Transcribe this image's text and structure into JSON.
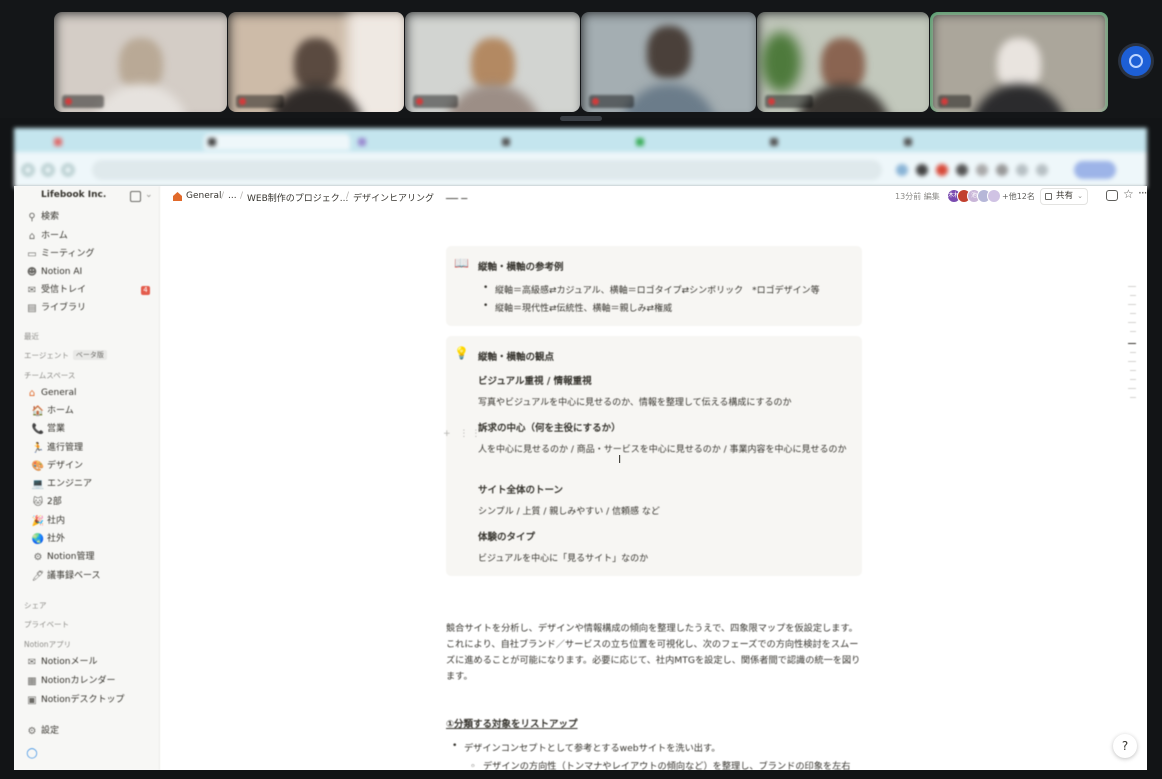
{
  "call": {
    "participants": [
      {
        "name": "",
        "color": "#d8d2ca",
        "accent": "#9c8f80"
      },
      {
        "name": "",
        "color": "#c9b8a6",
        "accent": "#3d3530"
      },
      {
        "name": "",
        "color": "#cfd0cc",
        "accent": "#a67c5a"
      },
      {
        "name": "",
        "color": "#8f9aa0",
        "accent": "#2f2b29"
      },
      {
        "name": "",
        "color": "#b9c3b2",
        "accent": "#7a5a48"
      },
      {
        "name": "",
        "color": "#a9a59c",
        "accent": "#ece8e4"
      }
    ]
  },
  "browser": {
    "tabs": [
      "",
      "",
      "",
      "",
      "",
      "",
      ""
    ],
    "address": ""
  },
  "workspace": {
    "name": "Lifebook Inc."
  },
  "sidebar": {
    "top_items": [
      {
        "label": "検索",
        "icon": "search-icon"
      },
      {
        "label": "ホーム",
        "icon": "home-icon"
      },
      {
        "label": "ミーティング",
        "icon": "meeting-icon"
      },
      {
        "label": "Notion AI",
        "icon": "notion-ai-icon"
      },
      {
        "label": "受信トレイ",
        "icon": "inbox-icon",
        "badge": "4"
      },
      {
        "label": "ライブラリ",
        "icon": "library-icon"
      }
    ],
    "recent_label": "最近",
    "agents_label": "エージェント",
    "beta_label": "ベータ版",
    "teamspace_label": "チームスペース",
    "teamspace_root": "General",
    "teamspace_items": [
      {
        "label": "ホーム",
        "icon": "house-emoji-icon"
      },
      {
        "label": "営業",
        "icon": "phone-emoji-icon"
      },
      {
        "label": "進行管理",
        "icon": "runner-emoji-icon"
      },
      {
        "label": "デザイン",
        "icon": "palette-emoji-icon"
      },
      {
        "label": "エンジニア",
        "icon": "computer-emoji-icon"
      },
      {
        "label": "2部",
        "icon": "cat-emoji-icon"
      },
      {
        "label": "社内",
        "icon": "party-emoji-icon"
      },
      {
        "label": "社外",
        "icon": "globe-emoji-icon"
      },
      {
        "label": "Notion管理",
        "icon": "gear-emoji-icon"
      },
      {
        "label": "議事録ベース",
        "icon": "pen-emoji-icon"
      }
    ],
    "shared_label": "シェア",
    "private_label": "プライベート",
    "apps_label": "Notionアプリ",
    "app_items": [
      {
        "label": "Notionメール",
        "icon": "mail-icon"
      },
      {
        "label": "Notionカレンダー",
        "icon": "calendar-icon"
      },
      {
        "label": "Notionデスクトップ",
        "icon": "desktop-icon"
      }
    ],
    "settings_label": "設定"
  },
  "topbar": {
    "breadcrumbs": [
      "General",
      "...",
      "WEB制作のプロジェク...",
      "デザインヒアリング"
    ],
    "edited": "13分前 編集",
    "avatars": [
      {
        "initials": "木村",
        "color": "#7a4bb0"
      },
      {
        "initials": "",
        "color": "#c2402f"
      },
      {
        "initials": "池",
        "color": "#c9b6d8"
      },
      {
        "initials": "",
        "color": "#b6b7d8"
      },
      {
        "initials": "",
        "color": "#d0c3e4"
      }
    ],
    "others": "+他12名",
    "share": "共有"
  },
  "page": {
    "callout1": {
      "icon": "📖",
      "title": "縦軸・横軸の参考例",
      "bullets": [
        "縦軸＝高級感⇄カジュアル、横軸＝ロゴタイプ⇄シンボリック　*ロゴデザイン等",
        "縦軸＝現代性⇄伝統性、横軸＝親しみ⇄権威"
      ]
    },
    "callout2": {
      "icon": "💡",
      "title": "縦軸・横軸の観点",
      "sections": [
        {
          "heading": "ビジュアル重視 / 情報重視",
          "text": "写真やビジュアルを中心に見せるのか、情報を整理して伝える構成にするのか"
        },
        {
          "heading": "訴求の中心（何を主役にするか）",
          "text": "人を中心に見せるのか / 商品・サービスを中心に見せるのか / 事業内容を中心に見せるのか"
        },
        {
          "heading": "サイト全体のトーン",
          "text": "シンプル / 上質 / 親しみやすい / 信頼感 など"
        },
        {
          "heading": "体験のタイプ",
          "text": "ビジュアルを中心に「見るサイト」なのか"
        }
      ]
    },
    "paragraph": "競合サイトを分析し、デザインや情報構成の傾向を整理したうえで、四象限マップを仮設定します。これにより、自社ブランド／サービスの立ち位置を可視化し、次のフェーズでの方向性検討をスムーズに進めることが可能になります。必要に応じて、社内MTGを設定し、関係者間で認識の統一を図ります。",
    "section_heading": "①分類する対象をリストアップ",
    "list_item": "デザインコンセプトとして参考とするwebサイトを洗い出す。",
    "list_subitem": "デザインの方向性（トンマナやレイアウトの傾向など）を整理し、ブランドの印象を左右する要素を明確化する。"
  },
  "help": "?"
}
